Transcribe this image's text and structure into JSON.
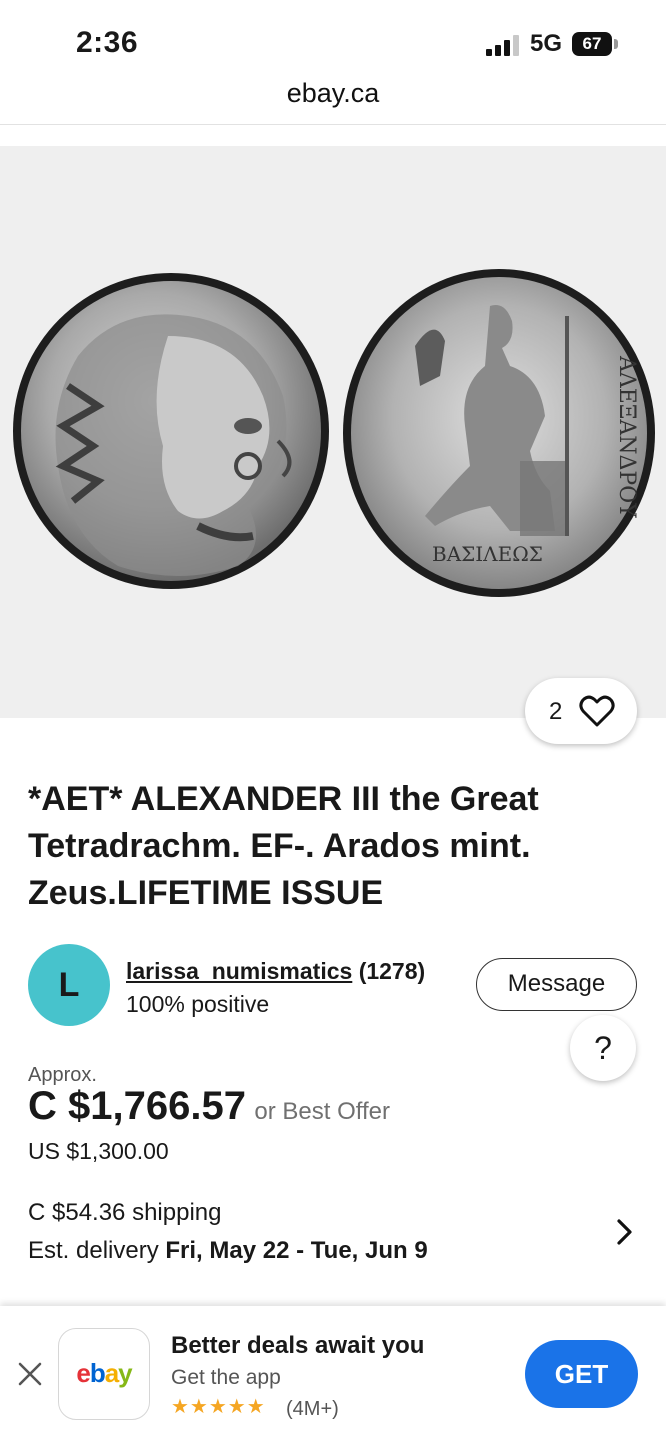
{
  "status_bar": {
    "time": "2:36",
    "network": "5G",
    "battery": "67"
  },
  "browser": {
    "url": "ebay.ca"
  },
  "listing": {
    "image": {
      "watch_count": "2",
      "left_coin_icon": "coin-obverse-heracles",
      "right_coin_icon": "coin-reverse-zeus"
    },
    "title": "*AET* ALEXANDER III the Great Tetradrachm. EF-. Arados mint. Zeus.LIFETIME ISSUE",
    "seller": {
      "avatar_letter": "L",
      "name": "larissa_numismatics",
      "feedback_count": "(1278)",
      "positive": "100% positive",
      "message_label": "Message",
      "avatar_color": "#47c3cc"
    },
    "help_label": "?",
    "price": {
      "approx_label": "Approx.",
      "value": "C $1,766.57",
      "best_offer": "or Best Offer",
      "us_value": "US $1,300.00"
    },
    "shipping": {
      "cost": "C $54.36 shipping",
      "delivery_label": "Est. delivery",
      "delivery_dates": "Fri, May 22 - Tue, Jun 9"
    }
  },
  "app_banner": {
    "logo_letters": [
      "e",
      "b",
      "a",
      "y"
    ],
    "logo_colors": [
      "#e53238",
      "#0064d2",
      "#f5af02",
      "#86b817"
    ],
    "title": "Better deals await you",
    "subtitle": "Get the app",
    "stars": "★★★★★",
    "rating_count": "(4M+)",
    "get_label": "GET",
    "accent": "#1a73e8"
  }
}
